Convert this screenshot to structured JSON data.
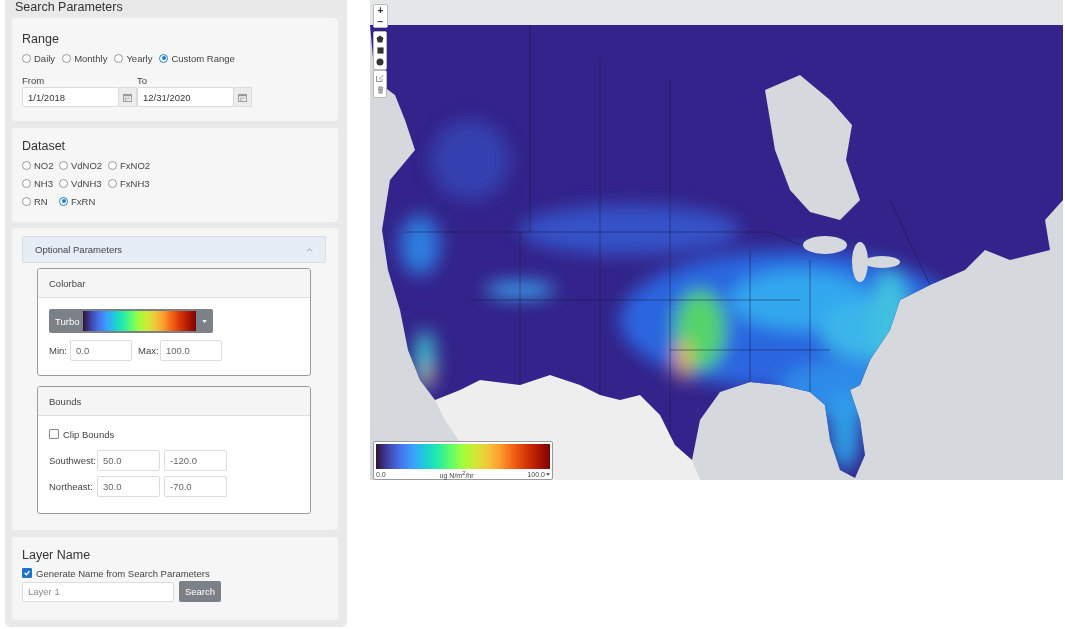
{
  "panel": {
    "title": "Search Parameters"
  },
  "range": {
    "title": "Range",
    "options": [
      {
        "label": "Daily",
        "selected": false
      },
      {
        "label": "Monthly",
        "selected": false
      },
      {
        "label": "Yearly",
        "selected": false
      },
      {
        "label": "Custom Range",
        "selected": true
      }
    ],
    "from": {
      "label": "From",
      "value": "1/1/2018"
    },
    "to": {
      "label": "To",
      "value": "12/31/2020"
    }
  },
  "dataset": {
    "title": "Dataset",
    "options": [
      {
        "label": "NO2",
        "selected": false
      },
      {
        "label": "VdNO2",
        "selected": false
      },
      {
        "label": "FxNO2",
        "selected": false
      },
      {
        "label": "NH3",
        "selected": false
      },
      {
        "label": "VdNH3",
        "selected": false
      },
      {
        "label": "FxNH3",
        "selected": false
      },
      {
        "label": "RN",
        "selected": false
      },
      {
        "label": "FxRN",
        "selected": true
      }
    ]
  },
  "optional_parameters": {
    "title": "Optional Parameters",
    "expanded": true,
    "colorbar": {
      "title": "Colorbar",
      "colormap": "Turbo",
      "min": {
        "label": "Min:",
        "value": "0.0"
      },
      "max": {
        "label": "Max:",
        "value": "100.0"
      }
    },
    "bounds": {
      "title": "Bounds",
      "clip_bounds": {
        "label": "Clip Bounds",
        "checked": false
      },
      "corners": [
        {
          "label": "Southwest:",
          "values": [
            "50.0",
            "-120.0"
          ]
        },
        {
          "label": "Northeast:",
          "values": [
            "30.0",
            "-70.0"
          ]
        }
      ]
    }
  },
  "layer_name": {
    "title": "Layer Name",
    "generate_name": {
      "label": "Generate Name from Search Parameters",
      "checked": true
    },
    "input": {
      "placeholder": "Layer 1"
    },
    "search_button": "Search"
  },
  "map": {
    "zoom_in": "+",
    "zoom_out": "−",
    "legend": {
      "min": "0.0",
      "unit": "ug N/m$^{2}$/hr",
      "max": "100.0"
    }
  }
}
